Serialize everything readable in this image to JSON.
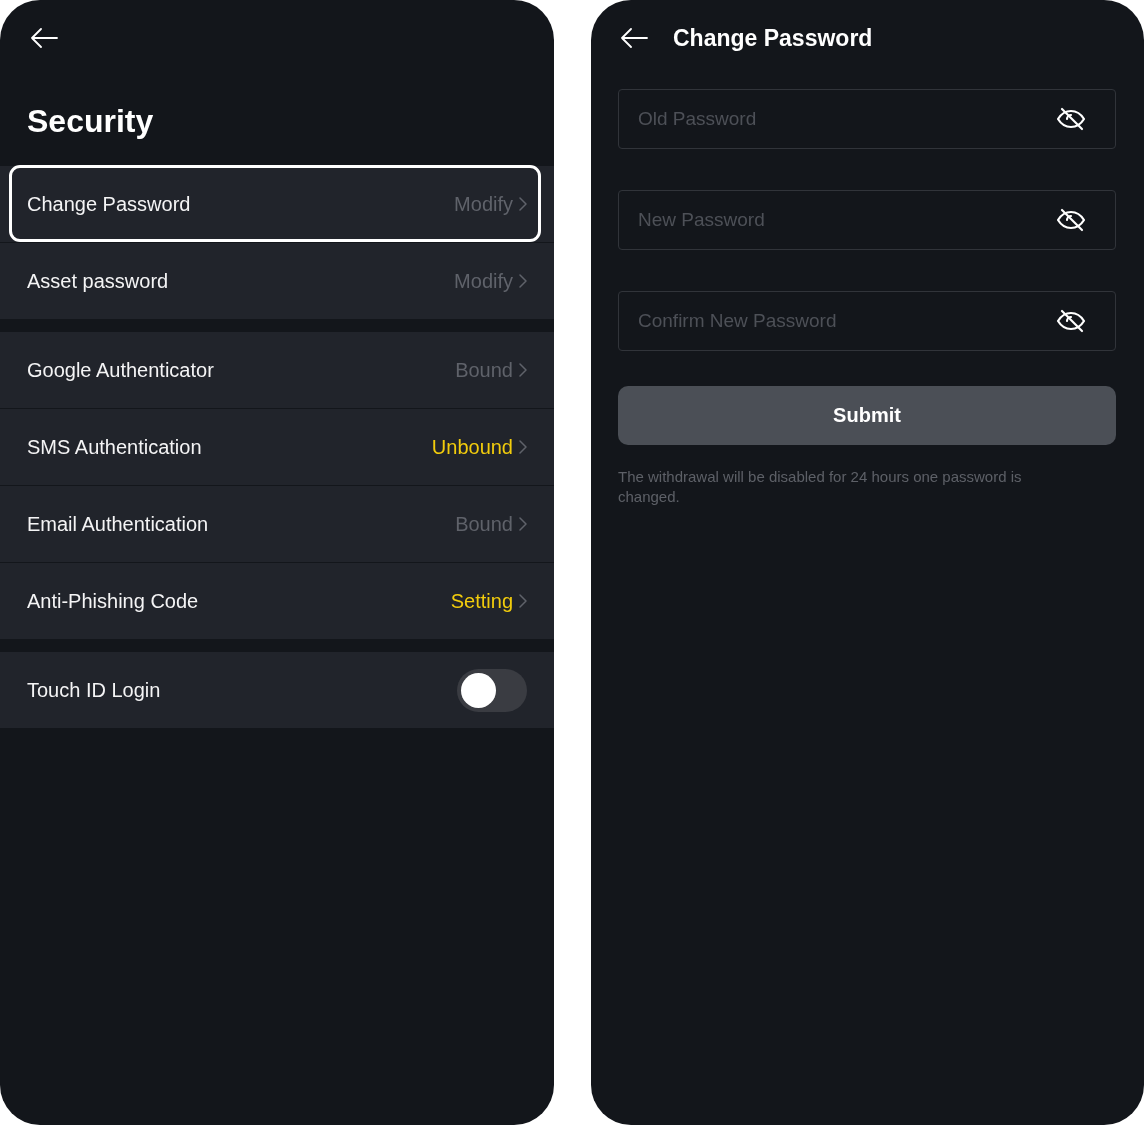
{
  "security_screen": {
    "title": "Security",
    "sections": [
      {
        "items": [
          {
            "kind": "link",
            "label": "Change Password",
            "value": "Modify",
            "color": "#5f626a",
            "selected": true
          },
          {
            "kind": "link",
            "label": "Asset password",
            "value": "Modify",
            "color": "#5f626a",
            "selected": false
          }
        ]
      },
      {
        "items": [
          {
            "kind": "link",
            "label": "Google Authenticator",
            "value": "Bound",
            "color": "#5f626a",
            "selected": false
          },
          {
            "kind": "link",
            "label": "SMS Authentication",
            "value": "Unbound",
            "color": "#f2cc0c",
            "selected": false
          },
          {
            "kind": "link",
            "label": "Email Authentication",
            "value": "Bound",
            "color": "#5f626a",
            "selected": false
          },
          {
            "kind": "link",
            "label": "Anti-Phishing Code",
            "value": "Setting",
            "color": "#f2cc0c",
            "selected": false
          }
        ]
      },
      {
        "items": [
          {
            "kind": "toggle",
            "label": "Touch ID Login",
            "on": false,
            "selected": false
          }
        ]
      }
    ]
  },
  "change_password_screen": {
    "title": "Change Password",
    "fields": [
      {
        "placeholder": "Old Password"
      },
      {
        "placeholder": "New Password"
      },
      {
        "placeholder": "Confirm New Password"
      }
    ],
    "submit_button": {
      "label": "Submit",
      "disabled": true
    },
    "note": "The withdrawal will be disabled for 24 hours one password is changed."
  }
}
